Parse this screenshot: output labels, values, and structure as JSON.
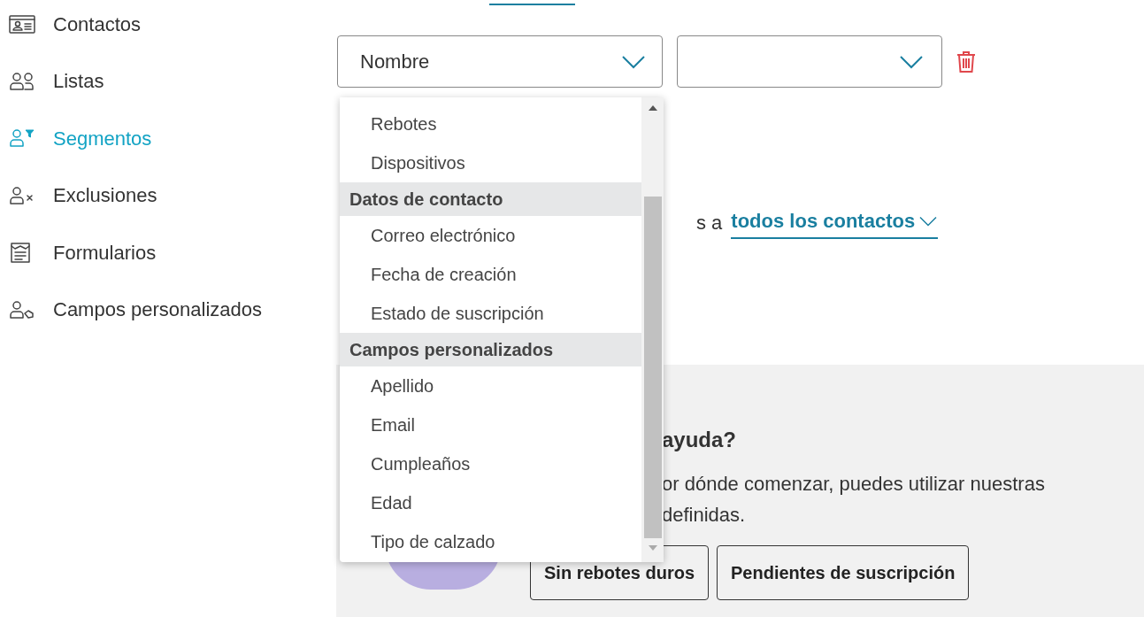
{
  "sidebar": {
    "items": [
      {
        "label": "Contactos",
        "selected": false
      },
      {
        "label": "Listas",
        "selected": false
      },
      {
        "label": "Segmentos",
        "selected": true
      },
      {
        "label": "Exclusiones",
        "selected": false
      },
      {
        "label": "Formularios",
        "selected": false
      },
      {
        "label": "Campos personalizados",
        "selected": false
      }
    ]
  },
  "condition": {
    "field_select": "Nombre"
  },
  "dropdown": {
    "items": [
      {
        "kind": "option",
        "label": "Rebotes",
        "selected": false
      },
      {
        "kind": "option",
        "label": "Dispositivos",
        "selected": false
      },
      {
        "kind": "group",
        "label": "Datos de contacto"
      },
      {
        "kind": "option",
        "label": "Correo electrónico",
        "selected": false
      },
      {
        "kind": "option",
        "label": "Fecha de creación",
        "selected": false
      },
      {
        "kind": "option",
        "label": "Estado de suscripción",
        "selected": false
      },
      {
        "kind": "group",
        "label": "Campos personalizados"
      },
      {
        "kind": "option",
        "label": "Apellido",
        "selected": false
      },
      {
        "kind": "option",
        "label": "Email",
        "selected": false
      },
      {
        "kind": "option",
        "label": "Cumpleaños",
        "selected": false
      },
      {
        "kind": "option",
        "label": "Edad",
        "selected": false
      },
      {
        "kind": "option",
        "label": "Tipo de calzado",
        "selected": false
      }
    ]
  },
  "audience": {
    "prefix": "s a",
    "link": "todos los contactos"
  },
  "help": {
    "title": "ayuda?",
    "text_lines": [
      "or dónde comenzar, puedes utilizar nuestras",
      "definidas."
    ],
    "buttons": [
      "Sin rebotes duros",
      "Pendientes de suscripción"
    ]
  }
}
